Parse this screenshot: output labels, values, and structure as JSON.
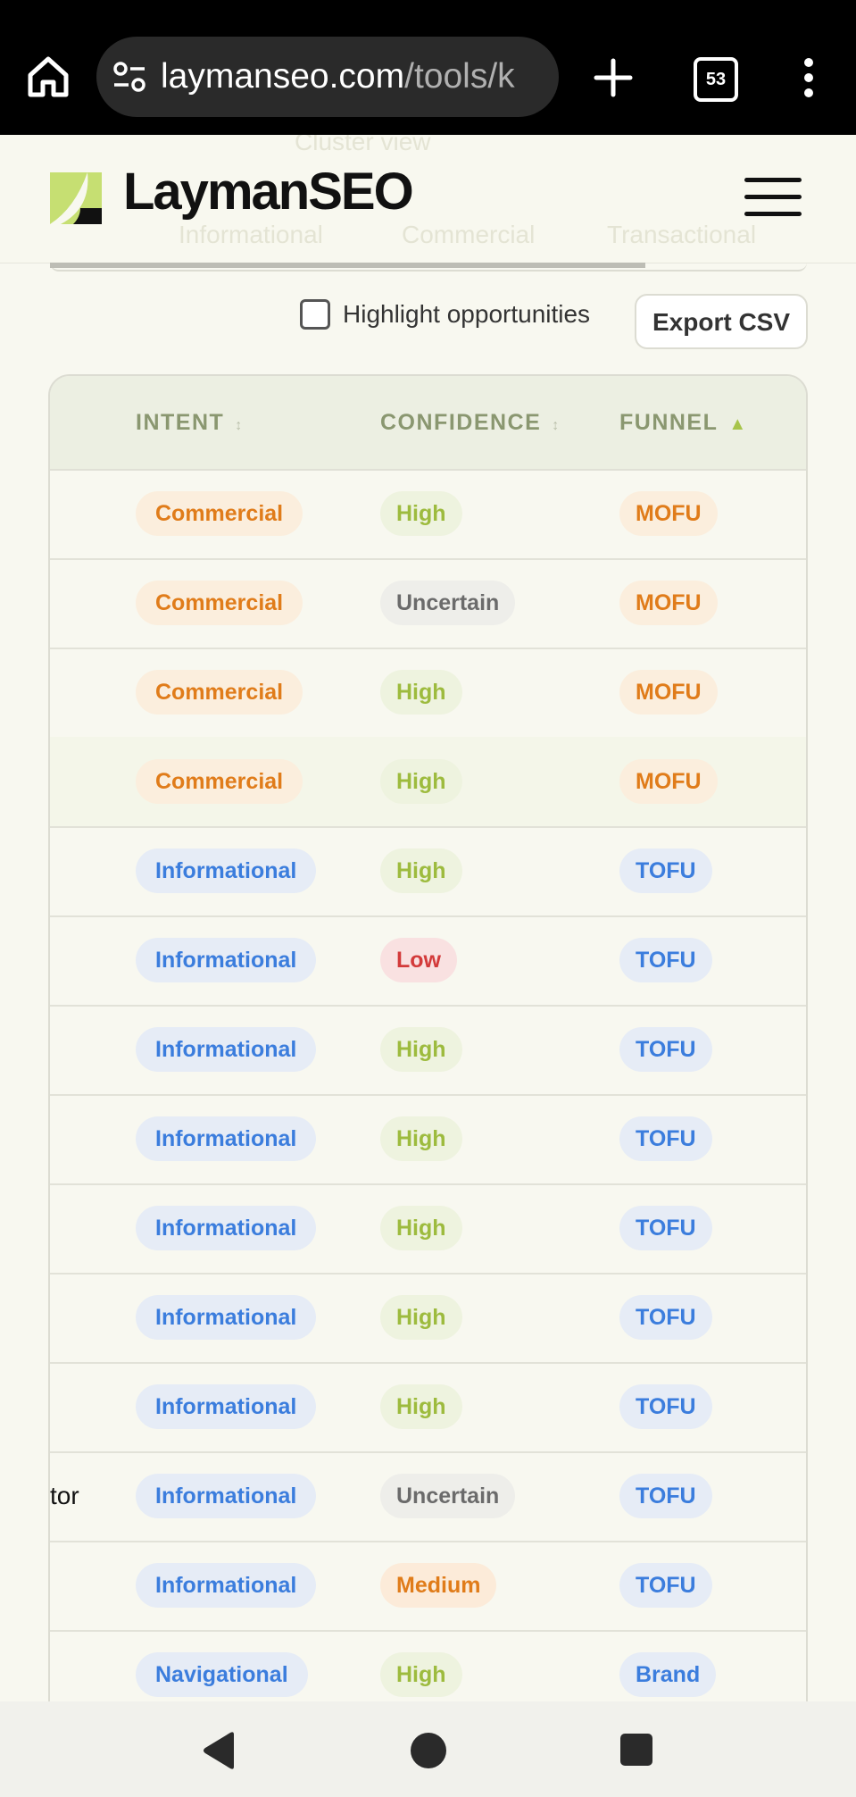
{
  "browser": {
    "url_host": "laymanseo.com",
    "url_path": "/tools/k",
    "tab_count": "53",
    "icons": [
      "home-icon",
      "tune-icon",
      "plus-icon",
      "tab-switcher-icon",
      "kebab-menu-icon"
    ]
  },
  "site": {
    "logo_text": "LaymanSEO",
    "ghost_tabs": [
      "Informational",
      "Commercial",
      "Transactional"
    ],
    "ghost_top": "Cluster view"
  },
  "controls": {
    "highlight_label": "Highlight opportunities",
    "highlight_checked": false,
    "export_label": "Export CSV"
  },
  "table": {
    "columns": [
      {
        "label": "INTENT",
        "sort": "↕"
      },
      {
        "label": "CONFIDENCE",
        "sort": "↕"
      },
      {
        "label": "FUNNEL",
        "sort": "▲"
      }
    ],
    "rows": [
      {
        "keyword": "",
        "intent": "Commercial",
        "confidence": "High",
        "funnel": "MOFU"
      },
      {
        "keyword": "",
        "intent": "Commercial",
        "confidence": "Uncertain",
        "funnel": "MOFU"
      },
      {
        "keyword": "",
        "intent": "Commercial",
        "confidence": "High",
        "funnel": "MOFU"
      },
      {
        "keyword": "",
        "intent": "Commercial",
        "confidence": "High",
        "funnel": "MOFU"
      },
      {
        "keyword": "",
        "intent": "Informational",
        "confidence": "High",
        "funnel": "TOFU"
      },
      {
        "keyword": "",
        "intent": "Informational",
        "confidence": "Low",
        "funnel": "TOFU"
      },
      {
        "keyword": "",
        "intent": "Informational",
        "confidence": "High",
        "funnel": "TOFU"
      },
      {
        "keyword": "",
        "intent": "Informational",
        "confidence": "High",
        "funnel": "TOFU"
      },
      {
        "keyword": "",
        "intent": "Informational",
        "confidence": "High",
        "funnel": "TOFU"
      },
      {
        "keyword": "",
        "intent": "Informational",
        "confidence": "High",
        "funnel": "TOFU"
      },
      {
        "keyword": "",
        "intent": "Informational",
        "confidence": "High",
        "funnel": "TOFU"
      },
      {
        "keyword": "tor",
        "intent": "Informational",
        "confidence": "Uncertain",
        "funnel": "TOFU"
      },
      {
        "keyword": "",
        "intent": "Informational",
        "confidence": "Medium",
        "funnel": "TOFU"
      },
      {
        "keyword": "",
        "intent": "Navigational",
        "confidence": "High",
        "funnel": "Brand"
      }
    ]
  },
  "navbar": {
    "icons": [
      "back-icon",
      "home-circle-icon",
      "recents-square-icon"
    ]
  }
}
